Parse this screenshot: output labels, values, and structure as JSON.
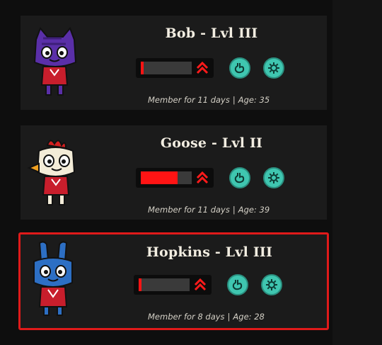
{
  "accent_color": "#e01a1a",
  "button_color": "#3fc6b0",
  "characters": [
    {
      "name_label": "Bob - Lvl III",
      "species": "cat",
      "fur_color": "#5a2fa8",
      "level_fill": 0.05,
      "member_label": "Member for 11 days",
      "separator": "|",
      "age_label": "Age: 35",
      "selected": false
    },
    {
      "name_label": "Goose - Lvl II",
      "species": "rooster",
      "fur_color": "#f3ecd8",
      "level_fill": 0.72,
      "member_label": "Member for 11 days",
      "separator": "|",
      "age_label": "Age: 39",
      "selected": false
    },
    {
      "name_label": "Hopkins - Lvl III",
      "species": "rabbit",
      "fur_color": "#2d6fc4",
      "level_fill": 0.05,
      "member_label": "Member for 8 days",
      "separator": "|",
      "age_label": "Age: 28",
      "selected": true
    }
  ],
  "icons": {
    "rank": "double-chevron-up-icon",
    "feed": "stomach-icon",
    "settings": "gear-icon"
  }
}
